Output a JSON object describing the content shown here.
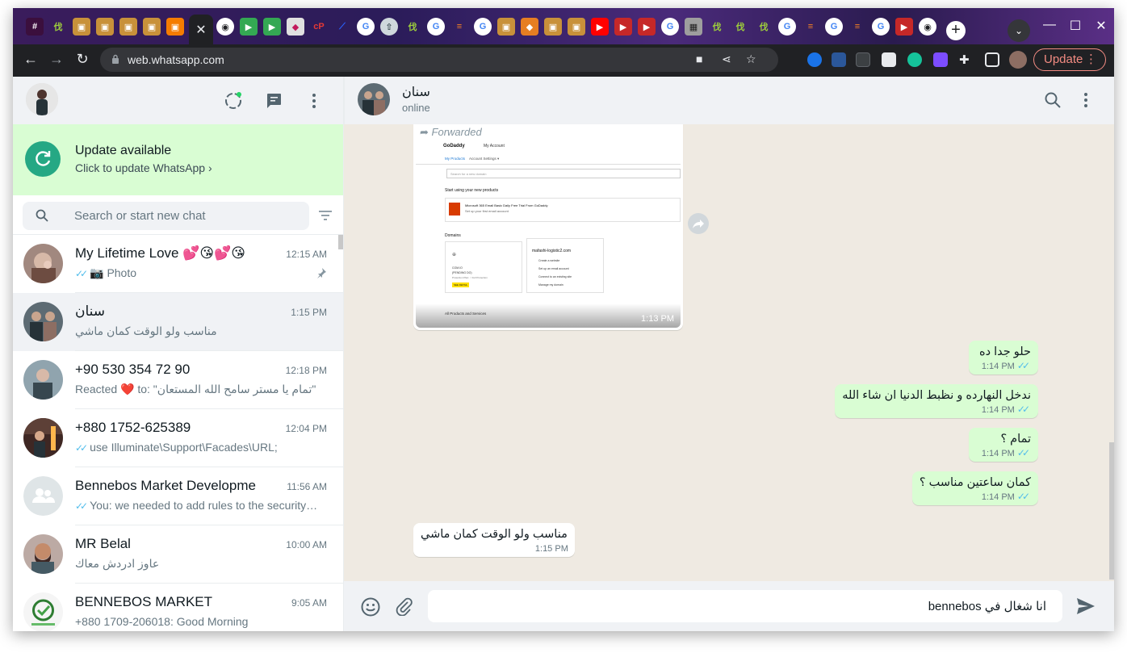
{
  "browser": {
    "url": "web.whatsapp.com",
    "update_label": "Update",
    "update_menu_glyph": "⋮",
    "tab_close_glyph": "✕",
    "new_tab_glyph": "+",
    "window_controls": [
      "—",
      "☐",
      "✕"
    ]
  },
  "sidebar": {
    "update_banner": {
      "title": "Update available",
      "subtitle": "Click to update WhatsApp ›"
    },
    "search": {
      "placeholder": "Search or start new chat"
    },
    "chats": [
      {
        "name": "My Lifetime Love 💕😘💕😘",
        "time": "12:15 AM",
        "preview": "Photo",
        "ticks": "✓✓",
        "pinned": true
      },
      {
        "name": "سنان",
        "time": "1:15 PM",
        "preview": "مناسب ولو الوقت كمان ماشي",
        "ticks": "",
        "pinned": false
      },
      {
        "name": "+90 530 354 72 90",
        "time": "12:18 PM",
        "preview": "Reacted ❤️ to: \"تمام يا مستر سامح الله المستعان\"",
        "ticks": "",
        "pinned": false
      },
      {
        "name": "+880 1752-625389",
        "time": "12:04 PM",
        "preview": "use Illuminate\\Support\\Facades\\URL;",
        "ticks": "✓✓",
        "pinned": false
      },
      {
        "name": "Bennebos Market Developme",
        "time": "11:56 AM",
        "preview": "You: we needed to add rules to the security…",
        "ticks": "✓✓",
        "pinned": false
      },
      {
        "name": "MR Belal",
        "time": "10:00 AM",
        "preview": "عاوز ادردش معاك",
        "ticks": "",
        "pinned": false
      },
      {
        "name": "BENNEBOS MARKET",
        "time": "9:05 AM",
        "preview": "+880 1709-206018: Good Morning",
        "ticks": "",
        "pinned": false
      }
    ]
  },
  "conversation": {
    "contact_name": "سنان",
    "contact_status": "online",
    "forwarded_label": "Forwarded",
    "image_time": "1:13 PM",
    "godaddy_shot": {
      "brand": "GoDaddy",
      "account": "My Account",
      "tabs": [
        "My Products",
        "Account Settings ▾"
      ],
      "search_placeholder": "Search for a new domain",
      "section1": "Start using your new products",
      "product_title": "Microsoft 365 Email Basic Daily Free Trial From GoDaddy",
      "product_sub": "Set up your first email account",
      "section2": "Domains",
      "card_left": [
        "COM.IO",
        "(PENDING DO)",
        "Protection Plan: ○ Full Protection",
        "SEE DETAIL"
      ],
      "card_right_title": "mafashi-logistic2.com",
      "card_right_items": [
        "Create a website",
        "Set up an email account",
        "Connect to an existing site",
        "Manage my domain"
      ],
      "footer": "All Products and Services"
    },
    "messages": [
      {
        "dir": "out",
        "text": "حلو جدا ده",
        "time": "1:14 PM",
        "ticks": "✓✓"
      },
      {
        "dir": "out",
        "text": "ندخل النهارده و نظبط الدنيا ان شاء الله",
        "time": "1:14 PM",
        "ticks": "✓✓"
      },
      {
        "dir": "out",
        "text": "تمام ؟",
        "time": "1:14 PM",
        "ticks": "✓✓"
      },
      {
        "dir": "out",
        "text": "كمان ساعتين مناسب ؟",
        "time": "1:14 PM",
        "ticks": "✓✓"
      },
      {
        "dir": "in",
        "text": "مناسب ولو الوقت كمان ماشي",
        "time": "1:15 PM",
        "ticks": ""
      }
    ],
    "draft": "انا شغال في bennebos"
  },
  "colors": {
    "accent": "#25a884",
    "outgoing_bubble": "#d9fdd3",
    "panel": "#f0f2f5",
    "chat_bg": "#efeae2",
    "read_ticks": "#53bdeb",
    "update_btn": "#f28b82"
  }
}
